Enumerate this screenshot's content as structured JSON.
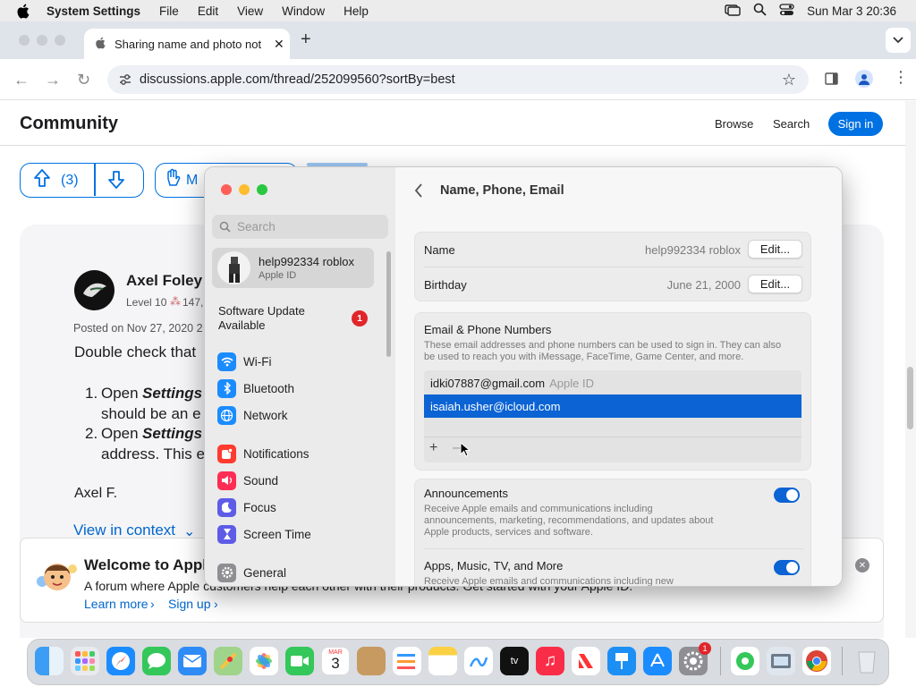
{
  "menubar": {
    "app": "System Settings",
    "items": [
      "File",
      "Edit",
      "View",
      "Window",
      "Help"
    ],
    "clock": "Sun Mar 3  20:36"
  },
  "browser": {
    "tab_title": "Sharing name and photo not",
    "url": "discussions.apple.com/thread/252099560?sortBy=best"
  },
  "community": {
    "title": "Community",
    "browse": "Browse",
    "search": "Search",
    "signin": "Sign in",
    "vote_count": "(3)",
    "metoo_label": "M",
    "author": "Axel Foley",
    "level": "Level 10",
    "level_points": "147,",
    "posted": "Posted on Nov 27, 2020 2",
    "line1": "Double check that",
    "step1_num": "1.",
    "step1_a": "Open ",
    "step1_b": "Settings",
    "step1_c": "should be an e",
    "step2_num": "2.",
    "step2_a": "Open ",
    "step2_b": "Settings",
    "step2_c": "address. This e",
    "sign": "Axel F.",
    "view_context": "View in context",
    "banner_title": "Welcome to Appl",
    "banner_text": "A forum where Apple customers help each other with their products. Get started with your Apple ID.",
    "learn_more": "Learn more",
    "sign_up": "Sign up"
  },
  "settings": {
    "search_placeholder": "Search",
    "account_name": "help992334 roblox",
    "account_sub": "Apple ID",
    "update_label": "Software Update Available",
    "update_badge": "1",
    "sidebar_items": [
      {
        "label": "Wi-Fi",
        "color": "#1a8cff"
      },
      {
        "label": "Bluetooth",
        "color": "#1a8cff"
      },
      {
        "label": "Network",
        "color": "#1a8cff"
      },
      {
        "label": "Notifications",
        "color": "#ff3b30"
      },
      {
        "label": "Sound",
        "color": "#ff2d55"
      },
      {
        "label": "Focus",
        "color": "#5e5ce6"
      },
      {
        "label": "Screen Time",
        "color": "#5e5ce6"
      },
      {
        "label": "General",
        "color": "#8e8e93"
      }
    ],
    "page_title": "Name, Phone, Email",
    "name_label": "Name",
    "name_value": "help992334 roblox",
    "birthday_label": "Birthday",
    "birthday_value": "June 21, 2000",
    "edit_label": "Edit...",
    "email_section_title": "Email & Phone Numbers",
    "email_section_desc": "These email addresses and phone numbers can be used to sign in. They can also be used to reach you with iMessage, FaceTime, Game Center, and more.",
    "email1": "idki07887@gmail.com",
    "email1_tag": "Apple ID",
    "email2": "isaiah.usher@icloud.com",
    "add_symbol": "+",
    "remove_symbol": "–",
    "announcements_title": "Announcements",
    "announcements_desc": "Receive Apple emails and communications including announcements, marketing, recommendations, and updates about Apple products, services and software.",
    "apps_title": "Apps, Music, TV, and More",
    "apps_desc": "Receive Apple emails and communications including new",
    "accent": "#0b63d4"
  },
  "dock": {
    "calendar_month": "MAR",
    "calendar_day": "3",
    "settings_badge": "1"
  }
}
